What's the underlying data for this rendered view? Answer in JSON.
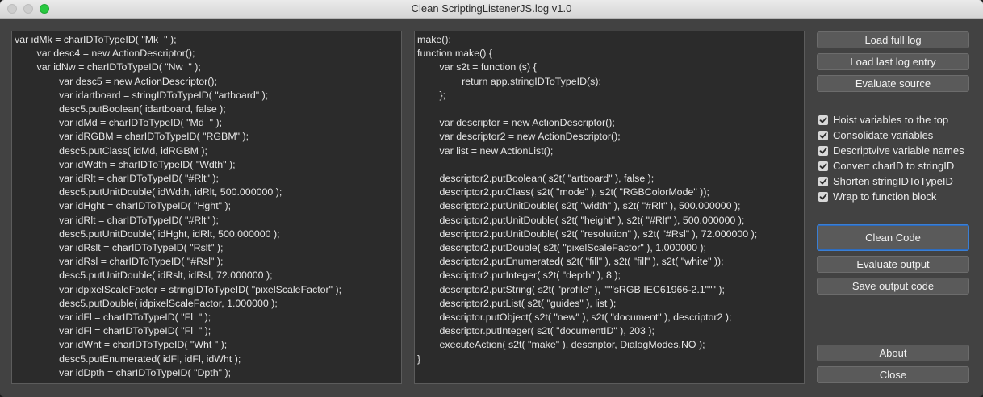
{
  "window": {
    "title": "Clean ScriptingListenerJS.log v1.0"
  },
  "source_code": {
    "lines": [
      "var idMk = charIDToTypeID( \"Mk  \" );",
      "        var desc4 = new ActionDescriptor();",
      "        var idNw = charIDToTypeID( \"Nw  \" );",
      "                var desc5 = new ActionDescriptor();",
      "                var idartboard = stringIDToTypeID( \"artboard\" );",
      "                desc5.putBoolean( idartboard, false );",
      "                var idMd = charIDToTypeID( \"Md  \" );",
      "                var idRGBM = charIDToTypeID( \"RGBM\" );",
      "                desc5.putClass( idMd, idRGBM );",
      "                var idWdth = charIDToTypeID( \"Wdth\" );",
      "                var idRlt = charIDToTypeID( \"#Rlt\" );",
      "                desc5.putUnitDouble( idWdth, idRlt, 500.000000 );",
      "                var idHght = charIDToTypeID( \"Hght\" );",
      "                var idRlt = charIDToTypeID( \"#Rlt\" );",
      "                desc5.putUnitDouble( idHght, idRlt, 500.000000 );",
      "                var idRslt = charIDToTypeID( \"Rslt\" );",
      "                var idRsl = charIDToTypeID( \"#Rsl\" );",
      "                desc5.putUnitDouble( idRslt, idRsl, 72.000000 );",
      "                var idpixelScaleFactor = stringIDToTypeID( \"pixelScaleFactor\" );",
      "                desc5.putDouble( idpixelScaleFactor, 1.000000 );",
      "                var idFl = charIDToTypeID( \"Fl  \" );",
      "                var idFl = charIDToTypeID( \"Fl  \" );",
      "                var idWht = charIDToTypeID( \"Wht \" );",
      "                desc5.putEnumerated( idFl, idFl, idWht );",
      "                var idDpth = charIDToTypeID( \"Dpth\" );"
    ]
  },
  "output_code": {
    "lines": [
      "make();",
      "function make() {",
      "        var s2t = function (s) {",
      "                return app.stringIDToTypeID(s);",
      "        };",
      "",
      "        var descriptor = new ActionDescriptor();",
      "        var descriptor2 = new ActionDescriptor();",
      "        var list = new ActionList();",
      "",
      "        descriptor2.putBoolean( s2t( \"artboard\" ), false );",
      "        descriptor2.putClass( s2t( \"mode\" ), s2t( \"RGBColorMode\" ));",
      "        descriptor2.putUnitDouble( s2t( \"width\" ), s2t( \"#Rlt\" ), 500.000000 );",
      "        descriptor2.putUnitDouble( s2t( \"height\" ), s2t( \"#Rlt\" ), 500.000000 );",
      "        descriptor2.putUnitDouble( s2t( \"resolution\" ), s2t( \"#Rsl\" ), 72.000000 );",
      "        descriptor2.putDouble( s2t( \"pixelScaleFactor\" ), 1.000000 );",
      "        descriptor2.putEnumerated( s2t( \"fill\" ), s2t( \"fill\" ), s2t( \"white\" ));",
      "        descriptor2.putInteger( s2t( \"depth\" ), 8 );",
      "        descriptor2.putString( s2t( \"profile\" ), \"\"\"sRGB IEC61966-2.1\"\"\" );",
      "        descriptor2.putList( s2t( \"guides\" ), list );",
      "        descriptor.putObject( s2t( \"new\" ), s2t( \"document\" ), descriptor2 );",
      "        descriptor.putInteger( s2t( \"documentID\" ), 203 );",
      "        executeAction( s2t( \"make\" ), descriptor, DialogModes.NO );",
      "}"
    ]
  },
  "buttons": {
    "load_full_log": "Load full log",
    "load_last_entry": "Load last log entry",
    "evaluate_source": "Evaluate source",
    "clean_code": "Clean Code",
    "evaluate_output": "Evaluate output",
    "save_output": "Save output code",
    "about": "About",
    "close": "Close"
  },
  "options": [
    {
      "label": "Hoist variables to the top",
      "checked": true
    },
    {
      "label": "Consolidate variables",
      "checked": true
    },
    {
      "label": "Descriptvive variable names",
      "checked": true
    },
    {
      "label": "Convert charID to stringID",
      "checked": true
    },
    {
      "label": "Shorten stringIDToTypeID",
      "checked": true
    },
    {
      "label": "Wrap to function block",
      "checked": true
    }
  ],
  "colors": {
    "window_bg": "#424242",
    "pane_bg": "#2b2b2b",
    "accent": "#3a7fd5",
    "maximize_button": "#28c940"
  }
}
